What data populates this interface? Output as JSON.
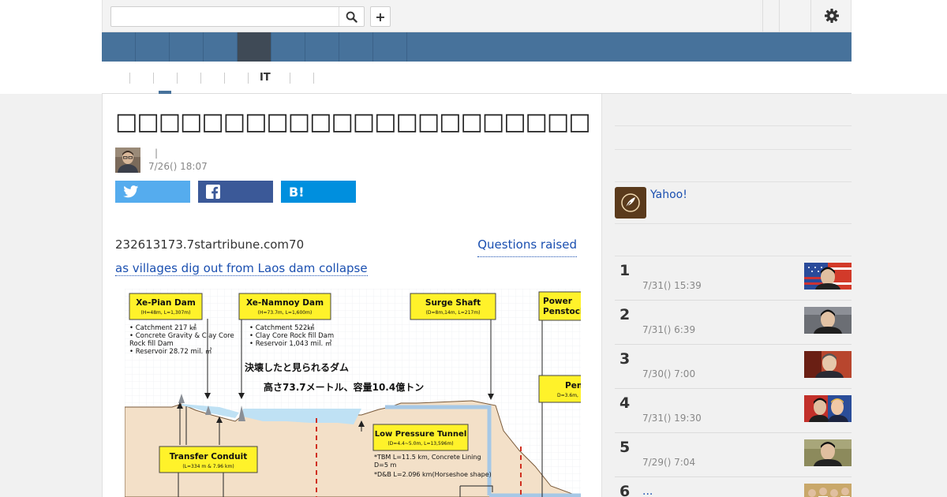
{
  "search": {
    "placeholder": "",
    "value": ""
  },
  "toolbar": {
    "add_label": "+"
  },
  "nav": {
    "tabs": [
      "",
      "",
      "",
      "",
      "",
      "",
      "",
      "",
      "",
      ""
    ]
  },
  "subnav": {
    "items": [
      "",
      "",
      "",
      "",
      "",
      "IT",
      ""
    ]
  },
  "article": {
    "headline": "□□□□□□□□□□□□□□□□□□□□□□",
    "author": "",
    "byline_sep": "|",
    "date": "7/26() 18:07",
    "body_text": "232613173.7startribune.com70",
    "link_part1": "Questions raised",
    "link_part2": "as villages dig out from Laos dam collapse",
    "share_hatena": "B!"
  },
  "figure": {
    "box_xepian_title": "Xe-Pian Dam",
    "box_xepian_sub": "(H=48m, L=1,307m)",
    "xepian_notes": [
      "• Catchment 217 ㎢",
      "• Concrete Gravity & Clay Core",
      "  Rock fill Dam",
      "• Reservoir 28.72 mil. ㎥"
    ],
    "box_xenamnoy_title": "Xe-Namnoy Dam",
    "box_xenamnoy_sub": "(H=73.7m, L=1,600m)",
    "xenamnoy_notes": [
      "• Catchment 522㎢",
      "• Clay Core Rock fill Dam",
      "• Reservoir  1,043 mil. ㎥"
    ],
    "box_surge_title": "Surge Shaft",
    "box_surge_sub": "(D=8m,14m, L=217m)",
    "box_power_title1": "Power",
    "box_power_title2": "Penstock",
    "box_pen_title": "Pen",
    "box_pen_sub": "D=3.6m,",
    "jp_caption1": "決壊したと見られるダム",
    "jp_caption2": "高さ73.7メートル、容量10.4億トン",
    "box_tunnel_title": "Low Pressure Tunnel",
    "box_tunnel_sub": "(D=4.4~5.0m, L=13,596m)",
    "tunnel_notes": [
      "*TBM L=11.5 km, Concrete Lining",
      "  D=5 m",
      "*D&B L=2.096 km(Horseshoe shape)"
    ],
    "box_conduit_title": "Transfer Conduit",
    "box_conduit_sub": "(L=334 m & 7.96 km)"
  },
  "sidebar": {
    "promo_text": "Yahoo!",
    "ranking": [
      {
        "num": "1",
        "title": "",
        "date": "7/31() 15:39"
      },
      {
        "num": "2",
        "title": "",
        "date": "7/31() 6:39"
      },
      {
        "num": "3",
        "title": "",
        "date": "7/30() 7:00"
      },
      {
        "num": "4",
        "title": "",
        "date": "7/31() 19:30"
      },
      {
        "num": "5",
        "title": "",
        "date": "7/29() 7:04"
      },
      {
        "num": "6",
        "title": "...",
        "date": ""
      }
    ]
  },
  "colors": {
    "nav": "#47729b",
    "nav_active": "#3f4a56",
    "link": "#1a4fb0",
    "twitter": "#55acee",
    "facebook": "#3b5998",
    "hatena": "#008fde"
  }
}
